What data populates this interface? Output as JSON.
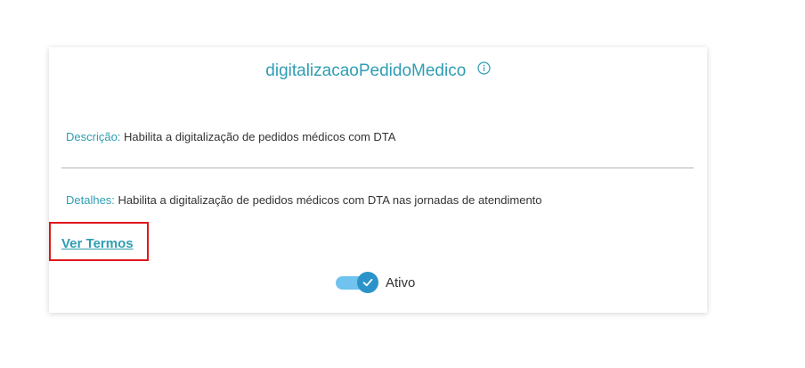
{
  "card": {
    "title": "digitalizacaoPedidoMedico",
    "info_icon": "info-circle-icon",
    "description": {
      "label": "Descrição:",
      "value": "Habilita a digitalização de pedidos médicos com DTA"
    },
    "details": {
      "label": "Detalhes:",
      "value": "Habilita a digitalização de pedidos médicos com DTA nas jornadas de atendimento"
    },
    "terms_link": "Ver Termos",
    "toggle": {
      "label": "Ativo",
      "checked": true,
      "check_icon": "check-icon"
    }
  },
  "colors": {
    "accent": "#2f9db3",
    "toggle_track": "#6fc3ee",
    "toggle_thumb": "#2b93c9",
    "highlight_box": "#e0161b"
  }
}
